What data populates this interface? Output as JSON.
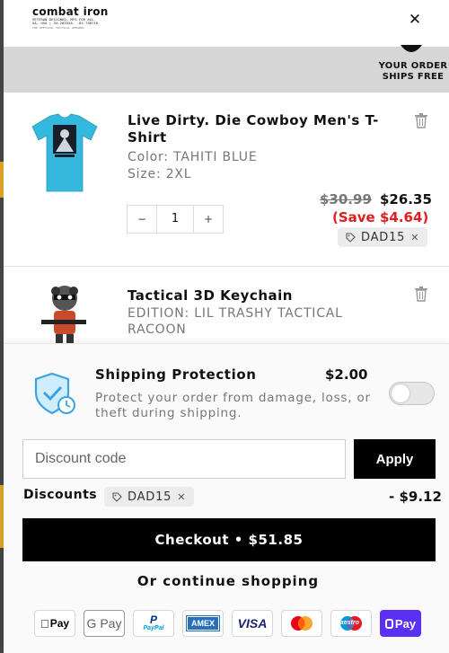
{
  "brand": {
    "logo_text": "combat iron",
    "logo_tagline": "VETERAN DESIGNED. MFG FOR ALL.",
    "logo_coords": "GA, USA | 34.283526, -83.798710",
    "logo_caption": "THE OFFICIAL TACTICAL APPAREL"
  },
  "header": {
    "close_icon": "close-icon"
  },
  "banner": {
    "ships_free_text": "YOUR ORDER SHIPS FREE",
    "icon": "truck-icon"
  },
  "cart": {
    "items": [
      {
        "title": "Live Dirty. Die Cowboy Men's T-Shirt",
        "color": "Color: TAHITI BLUE",
        "size": "Size: 2XL",
        "quantity": "1",
        "price_original": "$30.99",
        "price_current": "$26.35",
        "save_text": "(Save $4.64)",
        "discount_code": "DAD15",
        "thumb_color": "#35b8dd",
        "thumb_print": "LIVE DIRTY DIE COWBOY"
      },
      {
        "title": "Tactical 3D Keychain",
        "edition": "EDITION: LIL TRASHY TACTICAL RACOON"
      }
    ]
  },
  "shipping_protection": {
    "title": "Shipping Protection",
    "price": "$2.00",
    "description": "Protect your order from damage, loss, or theft during shipping.",
    "enabled": false,
    "icon": "shield-clock-icon"
  },
  "discount": {
    "placeholder": "Discount code",
    "apply_label": "Apply",
    "label": "Discounts",
    "code": "DAD15",
    "amount": "- $9.12"
  },
  "checkout": {
    "button_label": "Checkout • $51.85",
    "continue_label": "Or continue shopping"
  },
  "payment_methods": [
    {
      "name": "Apple Pay",
      "label": "Pay",
      "icon": "apple-pay-icon",
      "color": "#000000"
    },
    {
      "name": "Google Pay",
      "label": "G Pay",
      "icon": "google-pay-icon",
      "color": "#5f6368"
    },
    {
      "name": "PayPal",
      "label": "PayPal",
      "icon": "paypal-icon",
      "color": "#003087"
    },
    {
      "name": "American Express",
      "label": "AMEX",
      "icon": "amex-icon",
      "color": "#2671b9"
    },
    {
      "name": "Visa",
      "label": "VISA",
      "icon": "visa-icon",
      "color": "#1a1f71"
    },
    {
      "name": "Mastercard",
      "label": "",
      "icon": "mastercard-icon",
      "color": "#eb001b"
    },
    {
      "name": "Maestro",
      "label": "Maestro",
      "icon": "maestro-icon",
      "color": "#0099df"
    },
    {
      "name": "Shop Pay",
      "label": "Pay",
      "icon": "shop-pay-icon",
      "color": "#5a31f4"
    }
  ]
}
